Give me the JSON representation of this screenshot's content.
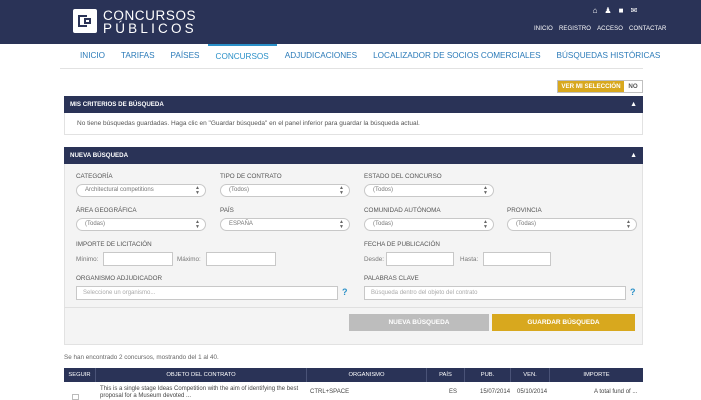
{
  "header": {
    "logo_line1": "CONCURSOS",
    "logo_line2": "PÚBLICOS",
    "icons": [
      "home-icon",
      "user-icon",
      "lock-icon",
      "mail-icon"
    ],
    "links": [
      "INICIO",
      "REGISTRO",
      "ACCESO",
      "CONTACTAR"
    ]
  },
  "nav": [
    "INICIO",
    "TARIFAS",
    "PAÍSES",
    "CONCURSOS",
    "ADJUDICACIONES",
    "LOCALIZADOR DE SOCIOS COMERCIALES",
    "BÚSQUEDAS HISTÓRICAS"
  ],
  "toggle": {
    "on": "VER MI SELECCIÓN",
    "off": "NO"
  },
  "criteria": {
    "title": "MIS CRITERIOS DE BÚSQUEDA",
    "message": "No tiene búsquedas guardadas. Haga clic en \"Guardar búsqueda\" en el panel inferior para guardar la búsqueda actual."
  },
  "search": {
    "title": "NUEVA BÚSQUEDA",
    "categoria": {
      "label": "CATEGORÍA",
      "value": "Architectural competitions"
    },
    "tipo": {
      "label": "TIPO DE CONTRATO",
      "value": "(Todos)"
    },
    "estado": {
      "label": "ESTADO DEL CONCURSO",
      "value": "(Todos)"
    },
    "area": {
      "label": "ÁREA GEOGRÁFICA",
      "value": "(Todas)"
    },
    "pais": {
      "label": "PAÍS",
      "value": "ESPAÑA"
    },
    "comunidad": {
      "label": "COMUNIDAD AUTÓNOMA",
      "value": "(Todas)"
    },
    "provincia": {
      "label": "PROVINCIA",
      "value": "(Todas)"
    },
    "importe": {
      "label": "IMPORTE DE LICITACIÓN",
      "min_label": "Mínimo:",
      "max_label": "Máximo:"
    },
    "fecha": {
      "label": "FECHA DE PUBLICACIÓN",
      "desde_label": "Desde:",
      "hasta_label": "Hasta:"
    },
    "organismo": {
      "label": "ORGANISMO ADJUDICADOR",
      "placeholder": "Seleccione un organismo..."
    },
    "palabras": {
      "label": "PALABRAS CLAVE",
      "placeholder": "Búsqueda dentro del objeto del contrato"
    },
    "help": "?",
    "new_button": "NUEVA BÚSQUEDA",
    "save_button": "GUARDAR BÚSQUEDA"
  },
  "results_text": "Se han encontrado 2 concursos, mostrando del 1 al 40.",
  "table": {
    "headers": [
      "SEGUIR",
      "OBJETO DEL CONTRATO",
      "ORGANISMO",
      "PAÍS",
      "PUB.",
      "VEN.",
      "IMPORTE"
    ],
    "rows": [
      {
        "objeto_line1": "This is a single stage Ideas Competition with the aim of identifying the best",
        "objeto_line2": "proposal for a Museum devoted ...",
        "organismo": "CTRL+SPACE",
        "pais": "ES",
        "pub": "15/07/2014",
        "ven": "05/10/2014",
        "importe": "A total fund of ..."
      }
    ]
  },
  "colors": {
    "navy": "#2a3357",
    "accent_blue": "#2a90c8",
    "gold": "#d8a81e",
    "grey_button": "#bdbdbd"
  }
}
